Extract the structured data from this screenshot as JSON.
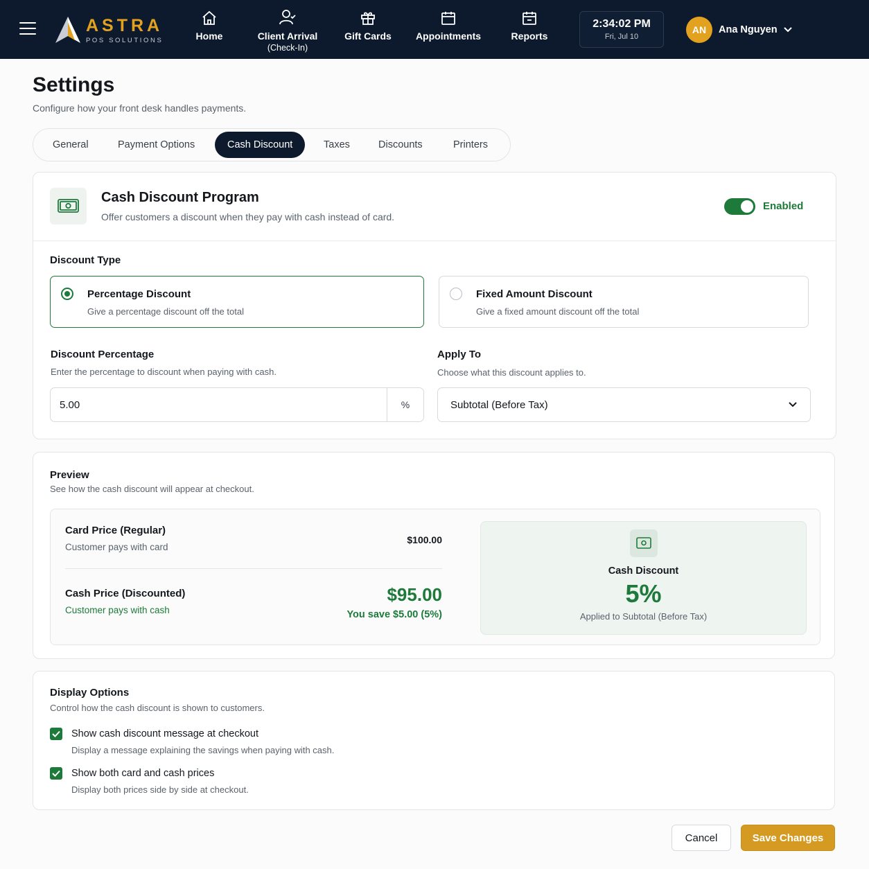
{
  "nav": {
    "brand_name": "ASTRA",
    "brand_sub": "POS SOLUTIONS",
    "items": [
      {
        "label": "Home",
        "sub": ""
      },
      {
        "label": "Client Arrival",
        "sub": "(Check-In)"
      },
      {
        "label": "Gift Cards",
        "sub": ""
      },
      {
        "label": "Appointments",
        "sub": ""
      },
      {
        "label": "Reports",
        "sub": ""
      }
    ],
    "clock_time": "2:34:02 PM",
    "clock_date": "Fri, Jul 10",
    "user_initials": "AN",
    "user_name": "Ana Nguyen"
  },
  "header": {
    "title": "Settings",
    "subtitle": "Configure how your front desk handles payments."
  },
  "tabs": [
    {
      "label": "General",
      "active": false
    },
    {
      "label": "Payment Options",
      "active": false
    },
    {
      "label": "Cash Discount",
      "active": true
    },
    {
      "label": "Taxes",
      "active": false
    },
    {
      "label": "Discounts",
      "active": false
    },
    {
      "label": "Printers",
      "active": false
    }
  ],
  "program": {
    "title": "Cash Discount Program",
    "subtitle": "Offer customers a discount when they pay with cash instead of card.",
    "toggle_label": "Enabled",
    "enabled": true
  },
  "discount_type": {
    "label": "Discount Type",
    "options": [
      {
        "title": "Percentage Discount",
        "desc": "Give a percentage discount off the total",
        "selected": true
      },
      {
        "title": "Fixed Amount Discount",
        "desc": "Give a fixed amount discount off the total",
        "selected": false
      }
    ]
  },
  "discount_percentage": {
    "label": "Discount Percentage",
    "help": "Enter the percentage to discount when paying with cash.",
    "value": "5.00",
    "suffix": "%"
  },
  "apply_to": {
    "label": "Apply To",
    "help": "Choose what this discount applies to.",
    "selected": "Subtotal (Before Tax)"
  },
  "preview": {
    "title": "Preview",
    "subtitle": "See how the cash discount will appear at checkout.",
    "card_label": "Card Price (Regular)",
    "card_sub": "Customer pays with card",
    "card_price": "$100.00",
    "cash_label": "Cash Price (Discounted)",
    "cash_sub": "Customer pays with cash",
    "cash_price": "$95.00",
    "savings": "You save $5.00 (5%)",
    "badge_title": "Cash Discount",
    "badge_pct": "5%",
    "badge_applied": "Applied to Subtotal (Before Tax)"
  },
  "display_options": {
    "title": "Display Options",
    "subtitle": "Control how the cash discount is shown to customers.",
    "items": [
      {
        "title": "Show cash discount message at checkout",
        "desc": "Display a message explaining the savings when paying with cash.",
        "checked": true
      },
      {
        "title": "Show both card and cash prices",
        "desc": "Display both prices side by side at checkout.",
        "checked": true
      }
    ]
  },
  "footer": {
    "cancel_label": "Cancel",
    "save_label": "Save Changes"
  },
  "colors": {
    "nav_bg": "#0d1a2d",
    "brand_gold": "#e2a21f",
    "accent_green": "#1d7a3a",
    "save_button": "#d49a22"
  },
  "icons": [
    "menu-icon",
    "home-icon",
    "user-icon",
    "gift-icon",
    "calendar-icon",
    "report-calendar-icon",
    "chevron-down-icon",
    "cash-icon",
    "check-icon"
  ]
}
